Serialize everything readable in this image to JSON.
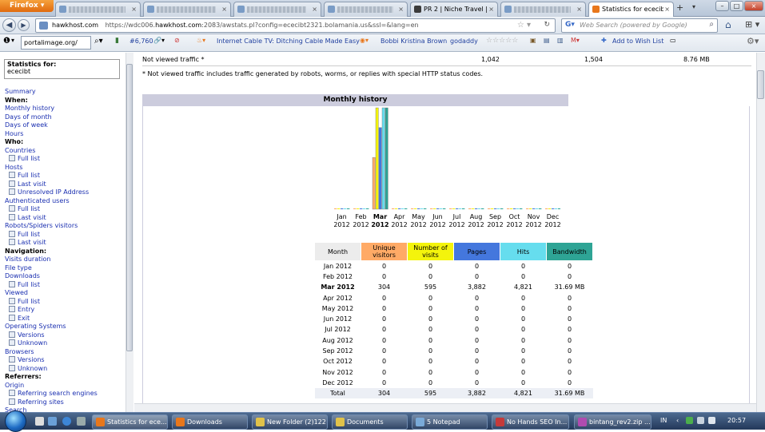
{
  "browser": {
    "menu_button": "Firefox",
    "tabs": [
      {
        "label": "",
        "blurred": true
      },
      {
        "label": "",
        "blurred": true
      },
      {
        "label": "",
        "blurred": true
      },
      {
        "label": "",
        "blurred": true
      },
      {
        "label": "PR 2 | Niche Travel |...",
        "blurred": false
      },
      {
        "label": "",
        "blurred": true
      },
      {
        "label": "Statistics for ececibt...",
        "blurred": false
      }
    ],
    "new_tab": "+",
    "url_host_prefix": "https://wdc006.",
    "url_host": "hawkhost.com",
    "url_rest": ":2083/awstats.pl?config=ececibt2321.bolamania.us&ssl=&lang=en",
    "url_site_label": "hawkhost.com",
    "search_placeholder": "Web Search (powered by Google)"
  },
  "bookmarks": {
    "portal_input": "portalimage.org/",
    "count": "#6,760",
    "link1": "Internet Cable TV: Ditching Cable Made Easy",
    "link2": "Bobbi Kristina Brown",
    "link3": "godaddy",
    "wishlist": "Add to Wish List"
  },
  "sidebar": {
    "stat_for_label": "Statistics for:",
    "stat_for_value": "ececibt",
    "items": [
      {
        "text": "Summary",
        "kind": "lnk"
      },
      {
        "text": "When:",
        "kind": "head"
      },
      {
        "text": "Monthly history",
        "kind": "lnk"
      },
      {
        "text": "Days of month",
        "kind": "lnk"
      },
      {
        "text": "Days of week",
        "kind": "lnk"
      },
      {
        "text": "Hours",
        "kind": "lnk"
      },
      {
        "text": "Who:",
        "kind": "head"
      },
      {
        "text": "Countries",
        "kind": "lnk"
      },
      {
        "text": "Full list",
        "kind": "sub"
      },
      {
        "text": "Hosts",
        "kind": "lnk"
      },
      {
        "text": "Full list",
        "kind": "sub"
      },
      {
        "text": "Last visit",
        "kind": "sub"
      },
      {
        "text": "Unresolved IP Address",
        "kind": "sub"
      },
      {
        "text": "Authenticated users",
        "kind": "lnk"
      },
      {
        "text": "Full list",
        "kind": "sub"
      },
      {
        "text": "Last visit",
        "kind": "sub"
      },
      {
        "text": "Robots/Spiders visitors",
        "kind": "lnk"
      },
      {
        "text": "Full list",
        "kind": "sub"
      },
      {
        "text": "Last visit",
        "kind": "sub"
      },
      {
        "text": "Navigation:",
        "kind": "head"
      },
      {
        "text": "Visits duration",
        "kind": "lnk"
      },
      {
        "text": "File type",
        "kind": "lnk"
      },
      {
        "text": "Downloads",
        "kind": "lnk"
      },
      {
        "text": "Full list",
        "kind": "sub"
      },
      {
        "text": "Viewed",
        "kind": "lnk"
      },
      {
        "text": "Full list",
        "kind": "sub"
      },
      {
        "text": "Entry",
        "kind": "sub"
      },
      {
        "text": "Exit",
        "kind": "sub"
      },
      {
        "text": "Operating Systems",
        "kind": "lnk"
      },
      {
        "text": "Versions",
        "kind": "sub"
      },
      {
        "text": "Unknown",
        "kind": "sub"
      },
      {
        "text": "Browsers",
        "kind": "lnk"
      },
      {
        "text": "Versions",
        "kind": "sub"
      },
      {
        "text": "Unknown",
        "kind": "sub"
      },
      {
        "text": "Referrers:",
        "kind": "head"
      },
      {
        "text": "Origin",
        "kind": "lnk"
      },
      {
        "text": "Referring search engines",
        "kind": "sub"
      },
      {
        "text": "Referring sites",
        "kind": "sub"
      },
      {
        "text": "Search",
        "kind": "lnk"
      }
    ]
  },
  "not_viewed": {
    "label": "Not viewed traffic *",
    "pages": "1,042",
    "hits": "1,504",
    "bandwidth": "8.76 MB"
  },
  "footnote": "* Not viewed traffic includes traffic generated by robots, worms, or replies with special HTTP status codes.",
  "monthly_history": {
    "title": "Monthly history",
    "headers": [
      "Month",
      "Unique visitors",
      "Number of visits",
      "Pages",
      "Hits",
      "Bandwidth"
    ],
    "header_colors": [
      "#ececec",
      "#ffaa66",
      "#f4f40c",
      "#4477dd",
      "#66ddee",
      "#2ea495"
    ],
    "rows": [
      [
        "Jan 2012",
        "0",
        "0",
        "0",
        "0",
        "0"
      ],
      [
        "Feb 2012",
        "0",
        "0",
        "0",
        "0",
        "0"
      ],
      [
        "Mar 2012",
        "304",
        "595",
        "3,882",
        "4,821",
        "31.69 MB"
      ],
      [
        "Apr 2012",
        "0",
        "0",
        "0",
        "0",
        "0"
      ],
      [
        "May 2012",
        "0",
        "0",
        "0",
        "0",
        "0"
      ],
      [
        "Jun 2012",
        "0",
        "0",
        "0",
        "0",
        "0"
      ],
      [
        "Jul 2012",
        "0",
        "0",
        "0",
        "0",
        "0"
      ],
      [
        "Aug 2012",
        "0",
        "0",
        "0",
        "0",
        "0"
      ],
      [
        "Sep 2012",
        "0",
        "0",
        "0",
        "0",
        "0"
      ],
      [
        "Oct 2012",
        "0",
        "0",
        "0",
        "0",
        "0"
      ],
      [
        "Nov 2012",
        "0",
        "0",
        "0",
        "0",
        "0"
      ],
      [
        "Dec 2012",
        "0",
        "0",
        "0",
        "0",
        "0"
      ]
    ],
    "total": [
      "Total",
      "304",
      "595",
      "3,882",
      "4,821",
      "31.69 MB"
    ]
  },
  "chart_data": {
    "type": "bar",
    "title": "",
    "categories": [
      "Jan",
      "Feb",
      "Mar",
      "Apr",
      "May",
      "Jun",
      "Jul",
      "Aug",
      "Sep",
      "Oct",
      "Nov",
      "Dec"
    ],
    "category_years": [
      "2012",
      "2012",
      "2012",
      "2012",
      "2012",
      "2012",
      "2012",
      "2012",
      "2012",
      "2012",
      "2012",
      "2012"
    ],
    "highlight_category": "Mar",
    "series": [
      {
        "name": "Unique visitors",
        "color": "#ffaa66",
        "values": [
          0,
          0,
          304,
          0,
          0,
          0,
          0,
          0,
          0,
          0,
          0,
          0
        ]
      },
      {
        "name": "Number of visits",
        "color": "#f4f40c",
        "values": [
          0,
          0,
          595,
          0,
          0,
          0,
          0,
          0,
          0,
          0,
          0,
          0
        ]
      },
      {
        "name": "Pages",
        "color": "#4477dd",
        "values": [
          0,
          0,
          3882,
          0,
          0,
          0,
          0,
          0,
          0,
          0,
          0,
          0
        ]
      },
      {
        "name": "Hits",
        "color": "#66ddee",
        "values": [
          0,
          0,
          4821,
          0,
          0,
          0,
          0,
          0,
          0,
          0,
          0,
          0
        ]
      },
      {
        "name": "Bandwidth",
        "color": "#2ea495",
        "values": [
          0,
          0,
          31.69,
          0,
          0,
          0,
          0,
          0,
          0,
          0,
          0,
          0
        ]
      }
    ]
  },
  "taskbar": {
    "tasks": [
      {
        "label": "Statistics for ece...",
        "icon": "#e8771c"
      },
      {
        "label": "Downloads",
        "icon": "#e8771c"
      },
      {
        "label": "New Folder (2)122",
        "icon": "#e0c24a"
      },
      {
        "label": "Documents",
        "icon": "#e0c24a"
      },
      {
        "label": "5 Notepad",
        "icon": "#7aaad8"
      },
      {
        "label": "No Hands SEO In...",
        "icon": "#c43a3a"
      },
      {
        "label": "bintang_rev2.zip ...",
        "icon": "#b04bb0"
      }
    ],
    "lang": "IN",
    "clock": "20:57"
  }
}
